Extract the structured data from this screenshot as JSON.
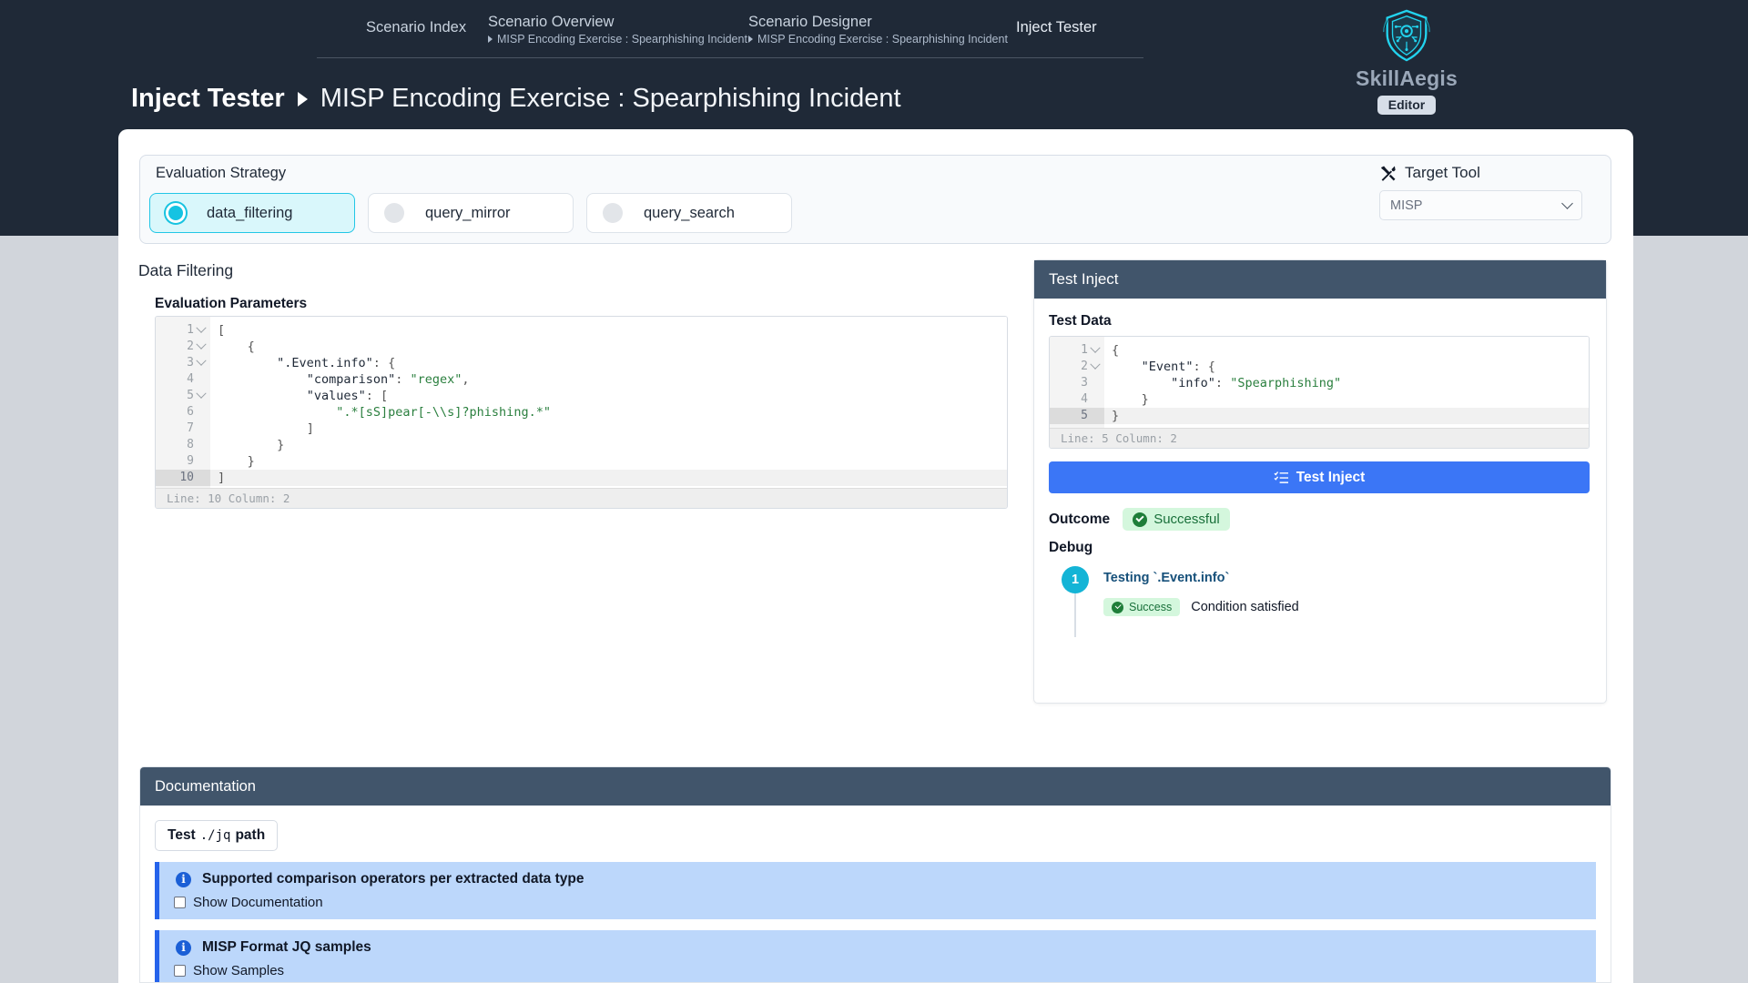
{
  "topnav": {
    "items": [
      {
        "title": "Scenario Index",
        "sub": ""
      },
      {
        "title": "Scenario Overview",
        "sub": "MISP Encoding Exercise : Spearphishing Incident"
      },
      {
        "title": "Scenario Designer",
        "sub": "MISP Encoding Exercise : Spearphishing Incident"
      },
      {
        "title": "Inject Tester",
        "sub": ""
      }
    ]
  },
  "logo": {
    "name": "SkillAegis",
    "badge": "Editor",
    "shield_color": "#22d3ee"
  },
  "page_title": {
    "main": "Inject Tester",
    "separator": "▶",
    "sub": "MISP Encoding Exercise : Spearphishing Incident"
  },
  "strategy": {
    "label": "Evaluation Strategy",
    "options": [
      {
        "label": "data_filtering",
        "selected": true
      },
      {
        "label": "query_mirror",
        "selected": false
      },
      {
        "label": "query_search",
        "selected": false
      }
    ],
    "selected_color": "#15c3e2"
  },
  "target_tool": {
    "label": "Target Tool",
    "icon": "tools-icon",
    "value": "MISP",
    "options": [
      "MISP"
    ]
  },
  "left_panel": {
    "section_title": "Data Filtering",
    "editor_title": "Evaluation Parameters",
    "editor": {
      "status": "Line: 10  Column: 2",
      "active_line": 10,
      "lines": [
        {
          "n": 1,
          "fold": true,
          "text": "["
        },
        {
          "n": 2,
          "fold": true,
          "text": "    {"
        },
        {
          "n": 3,
          "fold": true,
          "text": "        \".Event.info\": {"
        },
        {
          "n": 4,
          "fold": false,
          "text": "            \"comparison\": \"regex\","
        },
        {
          "n": 5,
          "fold": true,
          "text": "            \"values\": ["
        },
        {
          "n": 6,
          "fold": false,
          "text": "                \".*[sS]pear[-\\\\s]?phishing.*\""
        },
        {
          "n": 7,
          "fold": false,
          "text": "            ]"
        },
        {
          "n": 8,
          "fold": false,
          "text": "        }"
        },
        {
          "n": 9,
          "fold": false,
          "text": "    }"
        },
        {
          "n": 10,
          "fold": false,
          "text": "]"
        }
      ]
    }
  },
  "test_inject": {
    "header": "Test Inject",
    "test_data_label": "Test Data",
    "editor": {
      "status": "Line: 5  Column: 2",
      "active_line": 5,
      "lines": [
        {
          "n": 1,
          "fold": true,
          "text": "{"
        },
        {
          "n": 2,
          "fold": true,
          "text": "    \"Event\": {"
        },
        {
          "n": 3,
          "fold": false,
          "text": "        \"info\": \"Spearphishing\""
        },
        {
          "n": 4,
          "fold": false,
          "text": "    }"
        },
        {
          "n": 5,
          "fold": false,
          "text": "}"
        }
      ]
    },
    "button_label": "Test Inject",
    "button_icon": "list-check-icon",
    "button_color": "#3b76f6",
    "outcome_label": "Outcome",
    "outcome_value": "Successful",
    "outcome_color": "#19703a",
    "debug_label": "Debug",
    "debug_steps": [
      {
        "number": "1",
        "title": "Testing `.Event.info`",
        "status": "Success",
        "message": "Condition satisfied"
      }
    ]
  },
  "documentation": {
    "header": "Documentation",
    "test_button": {
      "prefix": "Test",
      "mono": "./jq",
      "suffix": "path"
    },
    "alerts": [
      {
        "title": "Supported comparison operators per extracted data type",
        "checkbox_label": "Show Documentation",
        "checked": false
      },
      {
        "title": "MISP Format JQ samples",
        "checkbox_label": "Show Samples",
        "checked": false
      }
    ]
  }
}
